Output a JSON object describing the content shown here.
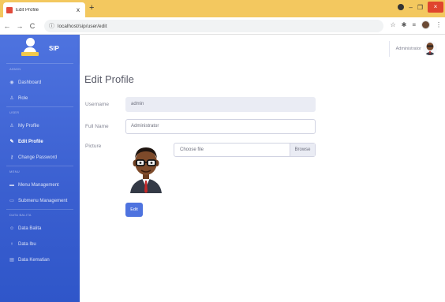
{
  "browser": {
    "tab_title": "Edit Profile",
    "tab_close": "x",
    "new_tab": "+",
    "url": "localhost/sip/user/edit",
    "win_min": "–",
    "win_max": "❐",
    "win_close": "×"
  },
  "sidebar": {
    "brand": "SIP",
    "sections": [
      {
        "heading": "ADMIN",
        "items": [
          {
            "label": "Dashboard",
            "icon": "dashboard-icon"
          },
          {
            "label": "Role",
            "icon": "user-icon"
          }
        ]
      },
      {
        "heading": "USER",
        "items": [
          {
            "label": "My Profile",
            "icon": "user-icon"
          },
          {
            "label": "Edit Profile",
            "icon": "user-edit-icon",
            "active": true
          },
          {
            "label": "Change Password",
            "icon": "key-icon"
          }
        ]
      },
      {
        "heading": "MENU",
        "items": [
          {
            "label": "Menu Management",
            "icon": "folder-icon"
          },
          {
            "label": "Submenu Management",
            "icon": "folder-open-icon"
          }
        ]
      },
      {
        "heading": "DATA BALITA",
        "items": [
          {
            "label": "Data Balita",
            "icon": "child-icon"
          },
          {
            "label": "Data Ibu",
            "icon": "female-icon"
          },
          {
            "label": "Data Kematian",
            "icon": "file-icon"
          }
        ]
      }
    ]
  },
  "topbar": {
    "user_name": "Administrator"
  },
  "main": {
    "title": "Edit Profile",
    "username_label": "Username",
    "username_value": "admin",
    "fullname_label": "Full Name",
    "fullname_value": "Administrator",
    "picture_label": "Picture",
    "file_placeholder": "Choose file",
    "browse_label": "Browse",
    "edit_button": "Edit"
  },
  "colors": {
    "primary": "#4e73df",
    "tabbar": "#f3c85f"
  }
}
